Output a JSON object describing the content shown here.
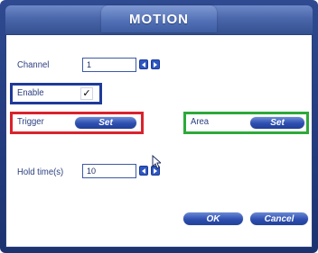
{
  "window": {
    "title": "MOTION"
  },
  "fields": {
    "channel": {
      "label": "Channel",
      "value": "1"
    },
    "enable": {
      "label": "Enable",
      "checked": true,
      "check_glyph": "✓"
    },
    "trigger": {
      "label": "Trigger",
      "button_label": "Set"
    },
    "area": {
      "label": "Area",
      "button_label": "Set"
    },
    "hold_time": {
      "label": "Hold time(s)",
      "value": "10"
    }
  },
  "actions": {
    "ok_label": "OK",
    "cancel_label": "Cancel"
  },
  "highlights": {
    "enable_color": "#1f3a9a",
    "trigger_color": "#d9232d",
    "area_color": "#2ea93a"
  },
  "icons": [
    "step-left-icon",
    "step-right-icon",
    "checkmark-icon",
    "mouse-pointer-icon"
  ]
}
